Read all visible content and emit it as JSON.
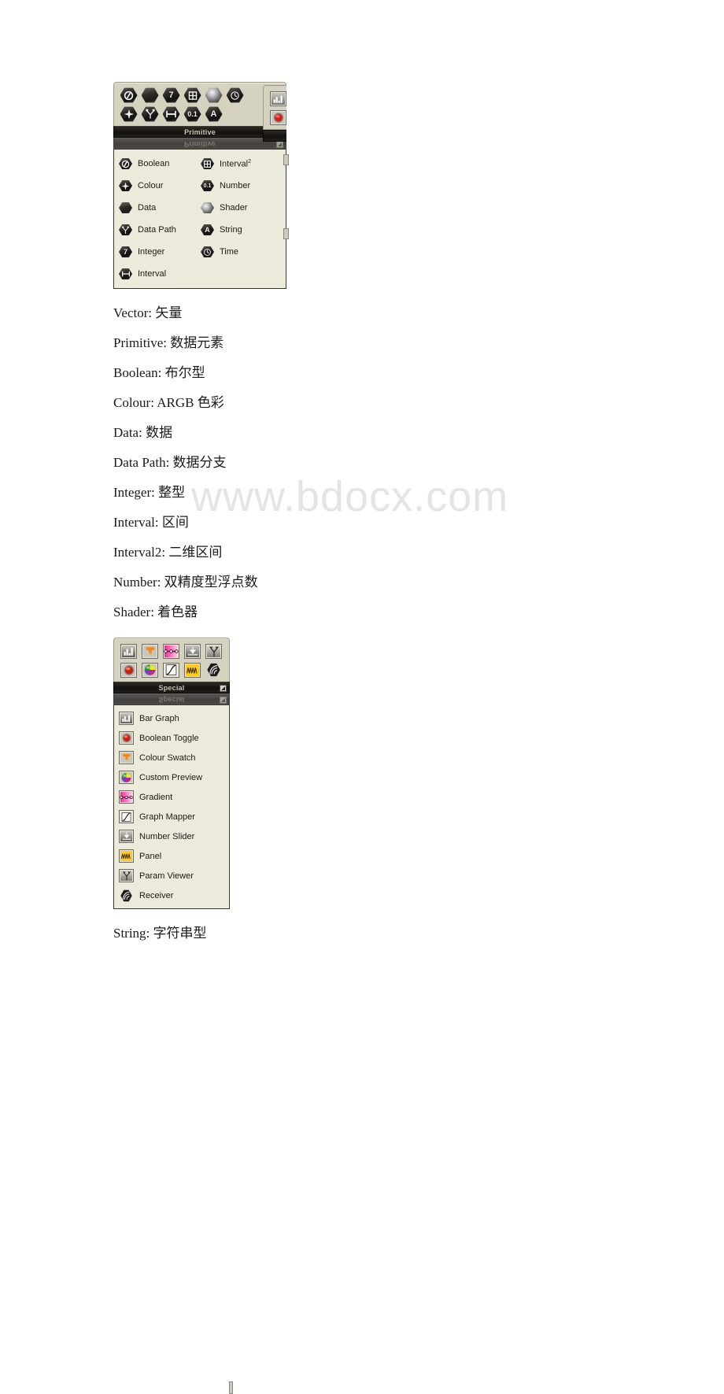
{
  "watermark": "www.bdocx.com",
  "primitive_panel": {
    "title": "Primitive",
    "reflection_title": "Primitive",
    "toolbar_icons": [
      {
        "name": "boolean-icon",
        "glyph": "boolean"
      },
      {
        "name": "data-icon",
        "glyph": "data"
      },
      {
        "name": "integer-icon",
        "glyph": "7"
      },
      {
        "name": "interval2-icon",
        "glyph": "interval2"
      },
      {
        "name": "shader-icon",
        "glyph": "shader"
      },
      {
        "name": "time-icon",
        "glyph": "time"
      },
      {
        "name": "colour-icon",
        "glyph": "colour"
      },
      {
        "name": "data-path-icon",
        "glyph": "datapath"
      },
      {
        "name": "interval-icon",
        "glyph": "interval"
      },
      {
        "name": "number-icon",
        "glyph": "0.1"
      },
      {
        "name": "string-icon",
        "glyph": "A"
      }
    ],
    "menu_left": [
      {
        "label": "Boolean",
        "icon": "boolean"
      },
      {
        "label": "Colour",
        "icon": "colour"
      },
      {
        "label": "Data",
        "icon": "data"
      },
      {
        "label": "Data Path",
        "icon": "datapath"
      },
      {
        "label": "Integer",
        "icon": "7"
      },
      {
        "label": "Interval",
        "icon": "interval"
      }
    ],
    "menu_right": [
      {
        "label": "Interval",
        "sup": "2",
        "icon": "interval2"
      },
      {
        "label": "Number",
        "icon": "0.1"
      },
      {
        "label": "Shader",
        "icon": "shader"
      },
      {
        "label": "String",
        "icon": "A"
      },
      {
        "label": "Time",
        "icon": "time"
      }
    ]
  },
  "glossary": [
    "Vector: 矢量",
    "Primitive: 数据元素",
    "Boolean: 布尔型",
    "Colour: ARGB 色彩",
    "Data: 数据",
    "Data Path: 数据分支",
    "Integer: 整型",
    "Interval: 区间",
    "Interval2: 二维区间",
    "Number: 双精度型浮点数",
    "Shader: 着色器"
  ],
  "special_panel": {
    "title": "Special",
    "reflection_title": "Special",
    "toolbar_icons": [
      {
        "name": "bar-graph-icon",
        "glyph": "bargraph"
      },
      {
        "name": "colour-swatch-icon",
        "glyph": "swatch"
      },
      {
        "name": "gradient-icon",
        "glyph": "gradient"
      },
      {
        "name": "number-slider-icon",
        "glyph": "slider"
      },
      {
        "name": "param-viewer-icon",
        "glyph": "paramviewer"
      },
      {
        "name": "boolean-toggle-icon",
        "glyph": "toggle"
      },
      {
        "name": "custom-preview-icon",
        "glyph": "preview"
      },
      {
        "name": "graph-mapper-icon",
        "glyph": "graphmapper"
      },
      {
        "name": "panel-icon",
        "glyph": "panel"
      },
      {
        "name": "receiver-icon",
        "glyph": "receiver"
      }
    ],
    "menu_items": [
      {
        "label": "Bar Graph",
        "icon": "bargraph"
      },
      {
        "label": "Boolean Toggle",
        "icon": "toggle"
      },
      {
        "label": "Colour Swatch",
        "icon": "swatch"
      },
      {
        "label": "Custom Preview",
        "icon": "preview"
      },
      {
        "label": "Gradient",
        "icon": "gradient"
      },
      {
        "label": "Graph Mapper",
        "icon": "graphmapper"
      },
      {
        "label": "Number Slider",
        "icon": "slider"
      },
      {
        "label": "Panel",
        "icon": "panel"
      },
      {
        "label": "Param Viewer",
        "icon": "paramviewer"
      },
      {
        "label": "Receiver",
        "icon": "receiver"
      }
    ]
  },
  "footer_line": "String: 字符串型",
  "colors": {
    "panel_face": "#d6d2c0",
    "menu_face": "#eceadb",
    "titlebar": "#1a1714",
    "title_text": "#cfc8b8",
    "body_text": "#1a1a1a",
    "watermark": "#e4e4e6",
    "panel_yellow": "#ffcc22",
    "toggle_red": "#cc2222"
  }
}
